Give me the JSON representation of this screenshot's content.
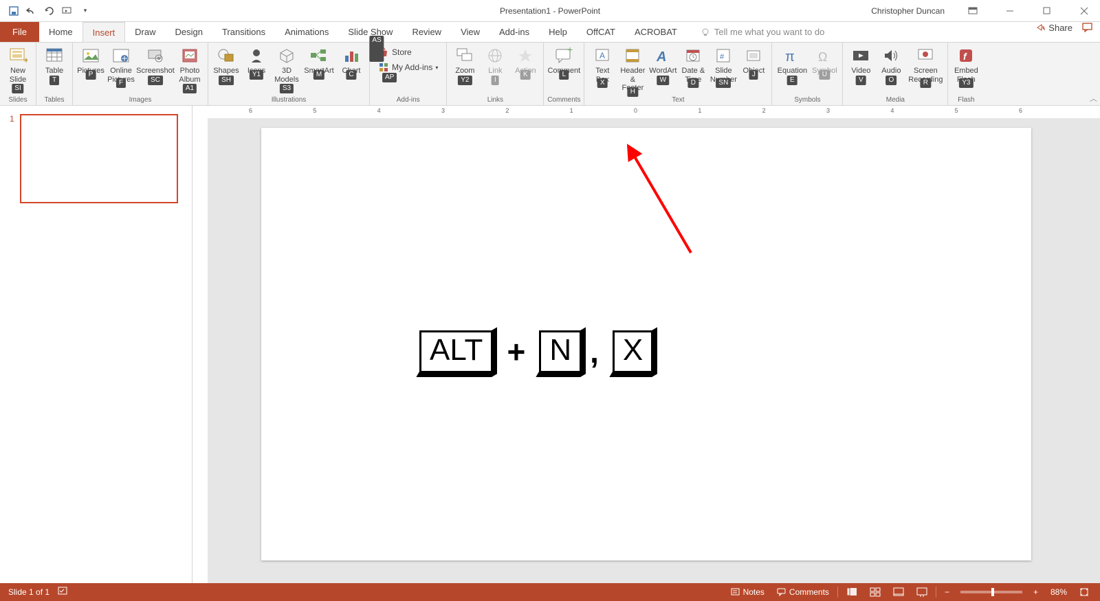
{
  "title": "Presentation1 - PowerPoint",
  "user": "Christopher Duncan",
  "tabs": {
    "file": "File",
    "home": "Home",
    "insert": "Insert",
    "draw": "Draw",
    "design": "Design",
    "transitions": "Transitions",
    "animations": "Animations",
    "slideshow": "Slide Show",
    "review": "Review",
    "view": "View",
    "addins": "Add-ins",
    "help": "Help",
    "offcat": "OffCAT",
    "acrobat": "ACROBAT"
  },
  "tellme_placeholder": "Tell me what you want to do",
  "share": "Share",
  "ribbon": {
    "newslide": "New\nSlide",
    "table": "Table",
    "pictures": "Pictures",
    "onlinepics": "Online\nPictures",
    "screenshot": "Screenshot",
    "photoalbum": "Photo\nAlbum",
    "shapes": "Shapes",
    "icons": "Icons",
    "models3d": "3D\nModels",
    "smartart": "SmartArt",
    "chart": "Chart",
    "store": "Store",
    "myaddins": "My Add-ins",
    "zoom": "Zoom",
    "link": "Link",
    "action": "Action",
    "comment": "Comment",
    "textbox": "Text\nBox",
    "headerfooter": "Header\n& Footer",
    "wordart": "WordArt",
    "datetime": "Date &\nTime",
    "slidenumber": "Slide\nNumber",
    "object": "Object",
    "equation": "Equation",
    "symbol": "Symbol",
    "video": "Video",
    "audio": "Audio",
    "screenrec": "Screen\nRecording",
    "embedflash": "Embed\nFlash"
  },
  "groups": {
    "slides": "Slides",
    "tables": "Tables",
    "images": "Images",
    "illustrations": "Illustrations",
    "addins": "Add-ins",
    "links": "Links",
    "comments": "Comments",
    "text": "Text",
    "symbols": "Symbols",
    "media": "Media",
    "flash": "Flash"
  },
  "keytips": {
    "newslide": "SI",
    "table": "T",
    "pictures": "P",
    "onlinepics": "F",
    "screenshot": "SC",
    "photoalbum": "A1",
    "shapes": "SH",
    "icons": "Y1",
    "models3d": "S3",
    "smartart": "M",
    "chart": "C",
    "store": "AS",
    "myaddins": "AP",
    "zoom": "Y2",
    "link": "I",
    "action": "K",
    "comment": "L",
    "textbox": "X",
    "headerfooter": "H",
    "wordart": "W",
    "datetime": "D",
    "slidenumber": "SN",
    "object": "J",
    "equation": "E",
    "symbol": "U",
    "video": "V",
    "audio": "O",
    "screenrec": "R",
    "embedflash": "Y3"
  },
  "slide_content": {
    "k1": "ALT",
    "plus": "+",
    "k2": "N",
    "comma": ",",
    "k3": "X"
  },
  "status": {
    "slide_of": "Slide 1 of 1",
    "notes": "Notes",
    "comments": "Comments",
    "zoom": "88%"
  },
  "thumb_number": "1",
  "ruler_marks": [
    "6",
    "5",
    "4",
    "3",
    "2",
    "1",
    "0",
    "1",
    "2",
    "3",
    "4",
    "5",
    "6"
  ]
}
